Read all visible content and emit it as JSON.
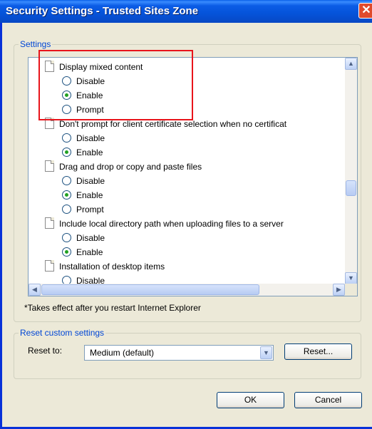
{
  "window": {
    "title": "Security Settings - Trusted Sites Zone",
    "close_glyph": "✕",
    "close_icon": "close-icon"
  },
  "settings": {
    "group_label": "Settings",
    "items": [
      {
        "kind": "category",
        "label": "Display mixed content"
      },
      {
        "kind": "option",
        "label": "Disable",
        "selected": false
      },
      {
        "kind": "option",
        "label": "Enable",
        "selected": true
      },
      {
        "kind": "option",
        "label": "Prompt",
        "selected": false
      },
      {
        "kind": "category",
        "label": "Don't prompt for client certificate selection when no certificat"
      },
      {
        "kind": "option",
        "label": "Disable",
        "selected": false
      },
      {
        "kind": "option",
        "label": "Enable",
        "selected": true
      },
      {
        "kind": "category",
        "label": "Drag and drop or copy and paste files"
      },
      {
        "kind": "option",
        "label": "Disable",
        "selected": false
      },
      {
        "kind": "option",
        "label": "Enable",
        "selected": true
      },
      {
        "kind": "option",
        "label": "Prompt",
        "selected": false
      },
      {
        "kind": "category",
        "label": "Include local directory path when uploading files to a server"
      },
      {
        "kind": "option",
        "label": "Disable",
        "selected": false
      },
      {
        "kind": "option",
        "label": "Enable",
        "selected": true
      },
      {
        "kind": "category",
        "label": "Installation of desktop items"
      },
      {
        "kind": "option",
        "label": "Disable",
        "selected": false
      }
    ],
    "note": "*Takes effect after you restart Internet Explorer"
  },
  "reset": {
    "group_label": "Reset custom settings",
    "reset_to_label": "Reset to:",
    "selected_value": "Medium (default)",
    "reset_button": "Reset..."
  },
  "footer": {
    "ok_label": "OK",
    "cancel_label": "Cancel"
  },
  "colors": {
    "title_bar": "#0553d9",
    "group_label": "#0046d5",
    "highlight_box": "#e8141b",
    "radio_selected": "#21a121"
  }
}
